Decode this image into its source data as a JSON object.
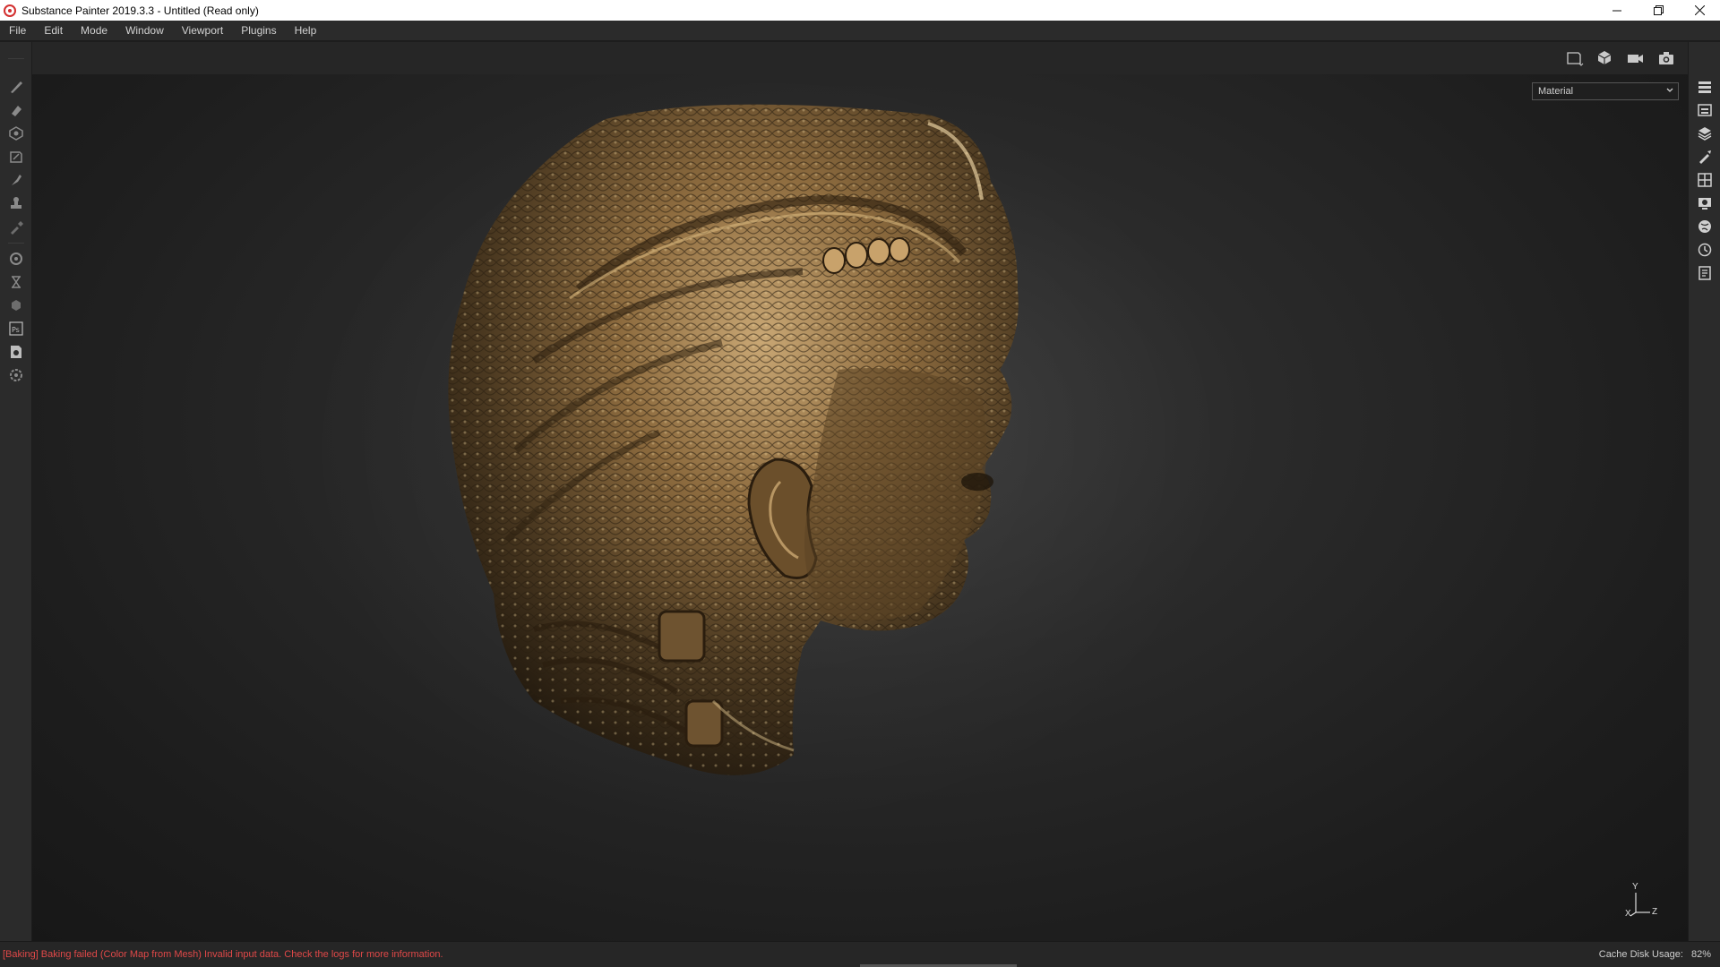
{
  "window": {
    "title": "Substance Painter 2019.3.3 - Untitled (Read only)"
  },
  "menu": {
    "items": [
      "File",
      "Edit",
      "Mode",
      "Window",
      "Viewport",
      "Plugins",
      "Help"
    ]
  },
  "viewport": {
    "mode_dropdown": {
      "selected": "Material"
    },
    "axes": {
      "y": "Y",
      "x": "X",
      "z": "Z"
    }
  },
  "status": {
    "error": "[Baking] Baking failed (Color Map from Mesh) Invalid input data. Check the logs for more information.",
    "cache_label": "Cache Disk Usage:",
    "cache_value": "82%"
  },
  "colors": {
    "error_text": "#e04848",
    "bronze": "#8a6a3a"
  },
  "icons": {
    "left_toolbar": [
      "paint-brush-icon",
      "eraser-icon",
      "projection-icon",
      "polygon-fill-icon",
      "smudge-icon",
      "clone-stamp-icon",
      "color-picker-icon",
      "bake-settings-icon",
      "export-icon",
      "display-settings-icon",
      "photoshop-icon",
      "substance-source-icon",
      "plugin-settings-icon"
    ],
    "right_toolbar": [
      "texture-set-list-icon",
      "texture-set-settings-icon",
      "layers-icon",
      "properties-icon",
      "shelf-icon",
      "display-settings-icon",
      "viewer-settings-icon",
      "history-icon",
      "log-icon"
    ],
    "top_toolbar": [
      "2d-view-icon",
      "3d-view-icon",
      "camera-icon",
      "screenshot-icon"
    ]
  }
}
